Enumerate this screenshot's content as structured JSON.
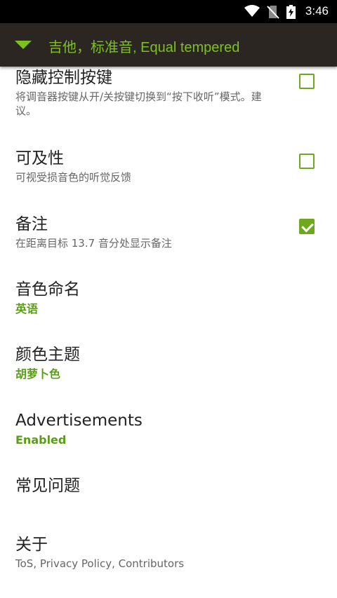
{
  "status_bar": {
    "time": "3:46",
    "icons": [
      "wifi-icon",
      "no-sim-icon",
      "battery-charging-icon"
    ]
  },
  "app_bar": {
    "title": "吉他，标准音, Equal tempered"
  },
  "settings": {
    "hide_controls": {
      "title": "隐藏控制按键",
      "summary": "将调音器按键从开/关按键切换到“按下收听”模式。建议。",
      "checked": false
    },
    "accessibility": {
      "title": "可及性",
      "summary": "可视受损音色的听觉反馈",
      "checked": false
    },
    "notes": {
      "title": "备注",
      "summary": "在距离目标 13.7 音分处显示备注",
      "checked": true
    },
    "note_naming": {
      "title": "音色命名",
      "value": "英语"
    },
    "color_theme": {
      "title": "颜色主题",
      "value": "胡萝卜色"
    },
    "ads": {
      "title": "Advertisements",
      "value": "Enabled"
    },
    "faq": {
      "title": "常见问题"
    },
    "about": {
      "title": "关于",
      "summary": "ToS, Privacy Policy, Contributors"
    }
  },
  "colors": {
    "accent": "#7cc11f",
    "toolbar": "#2b2622",
    "checkbox": "#6ea81d"
  }
}
